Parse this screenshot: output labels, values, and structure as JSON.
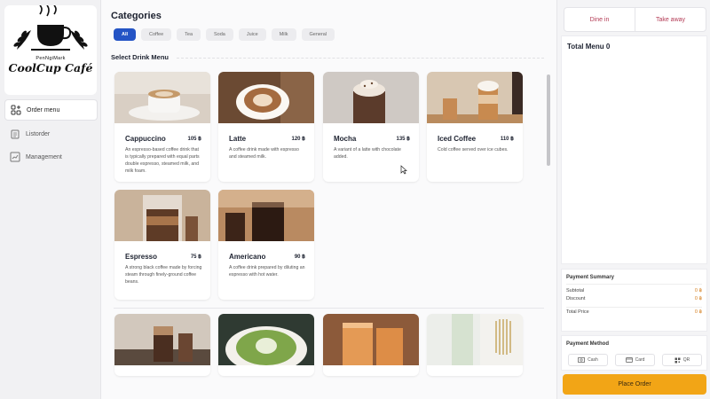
{
  "brand": {
    "top_text": "PenNgiMark",
    "name": "CoolCup Café"
  },
  "nav": [
    {
      "label": "Order menu",
      "icon": "grid-plus-icon"
    },
    {
      "label": "Listorder",
      "icon": "clipboard-icon"
    },
    {
      "label": "Management",
      "icon": "chart-icon"
    }
  ],
  "main": {
    "categories_title": "Categories",
    "categories": [
      "All",
      "Coffee",
      "Tea",
      "Soda",
      "Juice",
      "Milk",
      "General"
    ],
    "active_category": "All",
    "section_title": "Select Drink Menu",
    "items": [
      {
        "name": "Cappuccino",
        "price": "105 ฿",
        "description": "An espresso-based coffee drink that is typically prepared with equal parts double espresso, steamed milk, and milk foam."
      },
      {
        "name": "Latte",
        "price": "120 ฿",
        "description": "A coffee drink made with espresso and steamed milk."
      },
      {
        "name": "Mocha",
        "price": "135 ฿",
        "description": "A variant of a latte with chocolate added."
      },
      {
        "name": "Iced Coffee",
        "price": "110 ฿",
        "description": "Cold coffee served over ice cubes."
      },
      {
        "name": "Espresso",
        "price": "75 ฿",
        "description": "A strong black coffee made by forcing steam through finely-ground coffee beans."
      },
      {
        "name": "Americano",
        "price": "90 ฿",
        "description": "A coffee drink prepared by diluting an espresso with hot water."
      }
    ]
  },
  "order": {
    "dine_in": "Dine in",
    "take_away": "Take away",
    "total_menu": "Total Menu 0",
    "summary_title": "Payment Summary",
    "subtotal_label": "Subtotal",
    "subtotal_value": "0 ฿",
    "discount_label": "Discount",
    "discount_value": "0 ฿",
    "total_label": "Total Price",
    "total_value": "0 ฿",
    "method_title": "Payment Method",
    "methods": [
      "Cash",
      "Card",
      "QR"
    ],
    "place_order": "Place Order"
  },
  "colors": {
    "accent_blue": "#2454c5",
    "order_button": "#f2a516",
    "tab_text": "#b33b55"
  }
}
